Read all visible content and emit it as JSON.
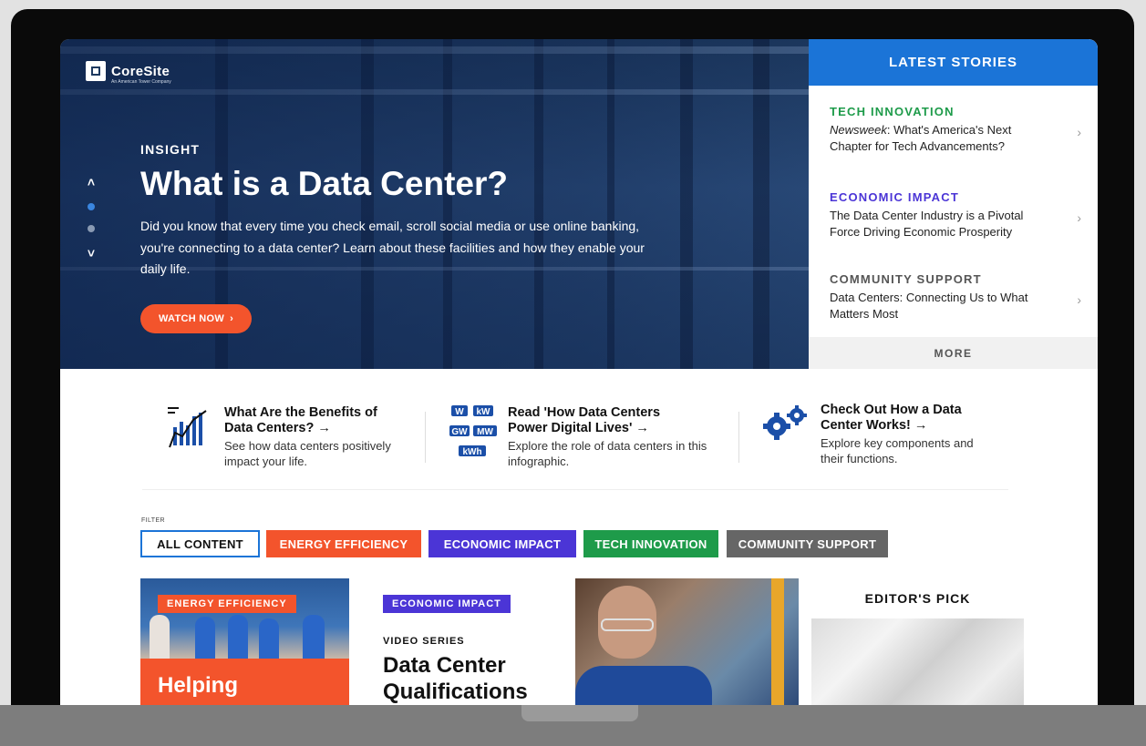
{
  "hero": {
    "logo_text": "CoreSite",
    "logo_sub": "An American Tower Company",
    "eyebrow": "INSIGHT",
    "title": "What is a Data Center?",
    "description": "Did you know that every time you check email, scroll social media or use online banking, you're connecting to a data center? Learn about these facilities and how they enable your daily life.",
    "cta_label": "WATCH NOW",
    "cta_arrow": "›",
    "nav_up": "˄",
    "nav_down": "˅"
  },
  "latest": {
    "heading": "LATEST STORIES",
    "stories": [
      {
        "category": "TECH INNOVATION",
        "color": "#1e9b4a",
        "publication": "Newsweek",
        "title": ": What's America's Next Chapter for Tech Advancements?"
      },
      {
        "category": "ECONOMIC IMPACT",
        "color": "#4b35d6",
        "title": "The Data Center Industry is a Pivotal Force Driving Economic Prosperity"
      },
      {
        "category": "COMMUNITY SUPPORT",
        "color": "#555555",
        "title": "Data Centers: Connecting Us to What Matters Most"
      }
    ],
    "chevron": "›",
    "more_label": "MORE"
  },
  "promos": [
    {
      "title": "What Are the Benefits of Data Centers? →",
      "desc": "See how data centers positively impact your life.",
      "icon": "bar-chart-icon"
    },
    {
      "title": "Read 'How Data Centers Power Digital Lives' →",
      "desc": "Explore the role of data centers in this infographic.",
      "icon": "kilowatt-icon",
      "icon_labels": [
        "W",
        "kW",
        "GW",
        "MW",
        "kWh"
      ]
    },
    {
      "title": "Check Out How a Data Center Works! →",
      "desc": "Explore key components and their functions.",
      "icon": "gears-icon"
    }
  ],
  "filter": {
    "label": "FILTER",
    "buttons": [
      {
        "label": "ALL CONTENT",
        "color": "#ffffff",
        "selected": true
      },
      {
        "label": "ENERGY EFFICIENCY",
        "color": "#f3542c"
      },
      {
        "label": "ECONOMIC IMPACT",
        "color": "#4b35d6"
      },
      {
        "label": "TECH INNOVATION",
        "color": "#1e9b4a"
      },
      {
        "label": "COMMUNITY SUPPORT",
        "color": "#666666"
      }
    ]
  },
  "cards": [
    {
      "tag": "ENERGY EFFICIENCY",
      "title": "Helping"
    },
    {
      "tag": "ECONOMIC IMPACT",
      "eyebrow": "VIDEO SERIES",
      "title_line1": "Data Center",
      "title_line2": "Qualifications"
    },
    {
      "kind": "photo"
    },
    {
      "heading": "EDITOR'S PICK"
    }
  ]
}
